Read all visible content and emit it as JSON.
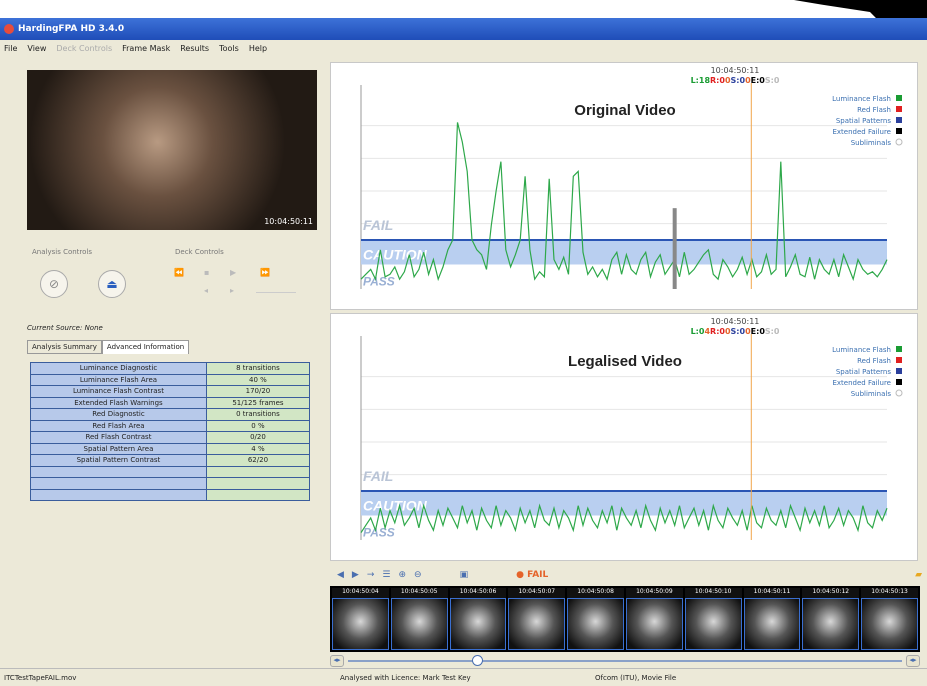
{
  "window": {
    "title": "HardingFPA HD 3.4.0"
  },
  "menu": [
    {
      "label": "File",
      "enabled": true
    },
    {
      "label": "View",
      "enabled": true
    },
    {
      "label": "Deck Controls",
      "enabled": false
    },
    {
      "label": "Frame Mask",
      "enabled": true
    },
    {
      "label": "Results",
      "enabled": true
    },
    {
      "label": "Tools",
      "enabled": true
    },
    {
      "label": "Help",
      "enabled": true
    }
  ],
  "left": {
    "video_timecode": "10:04:50:11",
    "analysis_controls_label": "Analysis Controls",
    "deck_controls_label": "Deck Controls",
    "current_source": "Current Source: None",
    "tabs": [
      "Analysis Summary",
      "Advanced Information"
    ],
    "info_rows": [
      [
        "Luminance Diagnostic",
        "8 transitions"
      ],
      [
        "Luminance Flash Area",
        "40 %"
      ],
      [
        "Luminance Flash Contrast",
        "170/20"
      ],
      [
        "Extended Flash Warnings",
        "51/125 frames"
      ],
      [
        "Red Diagnostic",
        "0 transitions"
      ],
      [
        "Red Flash Area",
        "0 %"
      ],
      [
        "Red Flash Contrast",
        "0/20"
      ],
      [
        "Spatial Pattern Area",
        "4 %"
      ],
      [
        "Spatial Pattern Contrast",
        "62/20"
      ],
      [
        "",
        ""
      ],
      [
        "",
        ""
      ],
      [
        "",
        ""
      ]
    ]
  },
  "legend": [
    "Luminance Flash",
    "Red Flash",
    "Spatial Patterns",
    "Extended Failure",
    "Subliminals"
  ],
  "legend_colors": [
    "#1a9c33",
    "#e02020",
    "#2a3f9c",
    "#000000",
    "#cccccc"
  ],
  "zones": {
    "fail": "FAIL",
    "caution": "CAUTION",
    "pass": "PASS"
  },
  "charts": {
    "original": {
      "title": "Original Video",
      "timecode": "10:04:50:11",
      "status_line": [
        {
          "t": "L:18",
          "c": "#1a9c33"
        },
        {
          "t": "R:0",
          "c": "#e02020"
        },
        {
          "t": "0",
          "c": "#e5632a"
        },
        {
          "t": "S:0",
          "c": "#2a3f9c"
        },
        {
          "t": "0",
          "c": "#e5632a"
        },
        {
          "t": "E:0",
          "c": "#000000"
        },
        {
          "t": "S:0",
          "c": "#bbbbbb"
        }
      ]
    },
    "legalised": {
      "title": "Legalised Video",
      "timecode": "10:04:50:11",
      "status_line": [
        {
          "t": "L:0",
          "c": "#1a9c33"
        },
        {
          "t": "4",
          "c": "#e5632a"
        },
        {
          "t": "R:0",
          "c": "#e02020"
        },
        {
          "t": "0",
          "c": "#e5632a"
        },
        {
          "t": "S:0",
          "c": "#2a3f9c"
        },
        {
          "t": "0",
          "c": "#e5632a"
        },
        {
          "t": "E:0",
          "c": "#000000"
        },
        {
          "t": "S:0",
          "c": "#bbbbbb"
        }
      ]
    }
  },
  "toolbar": {
    "fail_text": "FAIL"
  },
  "thumb_timecodes": [
    "10:04:50:04",
    "10:04:50:05",
    "10:04:50:06",
    "10:04:50:07",
    "10:04:50:08",
    "10:04:50:09",
    "10:04:50:10",
    "10:04:50:11",
    "10:04:50:12",
    "10:04:50:13"
  ],
  "status": {
    "file": "ITCTestTapeFAIL.mov",
    "licence": "Analysed with Licence: Mark Test Key",
    "mode": "Ofcom (ITU), Movie File"
  },
  "chart_data": [
    {
      "type": "line",
      "title": "Original Video",
      "ylim": [
        0,
        8
      ],
      "series": [
        {
          "name": "Luminance Flash",
          "values": [
            0.4,
            0.6,
            0.8,
            0.4,
            1.6,
            0.5,
            0.6,
            0.9,
            0.4,
            0.7,
            1.4,
            0.5,
            0.8,
            1.5,
            0.6,
            1.2,
            0.4,
            0.9,
            1.6,
            2.0,
            6.8,
            6.0,
            4.8,
            2.0,
            1.6,
            1.4,
            0.8,
            2.6,
            4.0,
            5.2,
            1.6,
            0.9,
            1.4,
            2.0,
            4.6,
            1.6,
            0.4,
            0.7,
            0.5,
            4.5,
            1.2,
            0.8,
            1.3,
            0.6,
            4.6,
            4.8,
            1.5,
            0.6,
            0.9,
            0.5,
            0.8,
            0.4,
            1.2,
            1.5,
            0.6,
            1.4,
            0.8,
            0.6,
            1.2,
            1.5,
            0.5,
            1.1,
            1.4,
            0.6,
            0.9,
            1.2,
            0.5,
            1.5,
            0.6,
            0.8,
            1.1,
            1.4,
            1.6,
            0.6,
            0.4,
            1.2,
            0.9,
            0.5,
            0.8,
            1.3,
            0.6,
            1.2,
            0.5,
            0.7,
            1.4,
            0.6,
            0.8,
            5.2,
            0.5,
            0.9,
            1.4,
            0.6,
            0.5,
            1.3,
            0.4,
            1.2,
            0.8,
            0.6,
            1.2,
            0.5,
            1.4,
            0.9,
            0.4,
            1.2,
            0.8,
            0.6,
            0.7,
            0.5,
            0.8,
            1.2
          ]
        },
        {
          "name": "Extended Failure",
          "values": [
            0,
            0,
            0,
            0,
            0,
            0,
            0,
            0,
            0,
            0,
            0,
            0,
            0,
            0,
            0,
            0,
            0,
            0,
            0,
            0,
            0,
            0,
            0,
            0,
            0,
            0,
            0,
            0,
            0,
            0,
            0,
            0,
            0,
            0,
            0,
            0,
            0,
            0,
            0,
            0,
            0,
            0,
            0,
            0,
            0,
            0,
            0,
            0,
            0,
            0,
            0,
            0,
            0,
            0,
            0,
            0,
            0,
            0,
            0,
            0,
            0,
            0,
            0,
            0,
            0,
            3.3,
            0,
            0,
            0,
            0,
            0,
            0,
            0,
            0,
            0,
            0,
            0,
            0,
            0,
            0,
            0,
            0,
            0,
            0,
            0,
            0,
            0,
            0,
            0,
            0,
            0,
            0,
            0,
            0,
            0,
            0,
            0,
            0,
            0,
            0,
            0,
            0,
            0,
            0,
            0,
            0,
            0,
            0,
            0,
            0
          ]
        }
      ]
    },
    {
      "type": "line",
      "title": "Legalised Video",
      "ylim": [
        0,
        8
      ],
      "series": [
        {
          "name": "Luminance Flash",
          "values": [
            0.3,
            0.6,
            0.9,
            0.4,
            1.3,
            0.5,
            1.2,
            0.7,
            1.4,
            0.6,
            0.9,
            1.3,
            0.5,
            1.4,
            0.8,
            0.4,
            1.2,
            0.6,
            1.3,
            0.9,
            0.5,
            1.4,
            0.7,
            1.2,
            0.4,
            1.3,
            0.8,
            0.5,
            1.4,
            0.6,
            1.2,
            0.9,
            0.4,
            1.3,
            0.7,
            1.2,
            0.5,
            1.4,
            0.8,
            0.6,
            1.3,
            0.5,
            1.2,
            0.9,
            0.4,
            1.4,
            0.6,
            1.3,
            0.8,
            0.5,
            1.2,
            0.7,
            1.4,
            0.4,
            1.3,
            0.9,
            0.6,
            1.2,
            0.5,
            1.4,
            0.8,
            0.4,
            1.3,
            0.7,
            1.2,
            0.6,
            1.4,
            0.5,
            0.9,
            1.3,
            0.6,
            1.2,
            0.4,
            1.4,
            0.8,
            0.5,
            1.3,
            0.9,
            0.6,
            1.2,
            0.4,
            1.4,
            0.7,
            0.5,
            1.3,
            0.8,
            0.6,
            1.2,
            0.5,
            1.4,
            0.9,
            0.4,
            1.3,
            0.7,
            1.2,
            0.6,
            1.4,
            0.5,
            0.8,
            1.3,
            0.6,
            1.2,
            0.9,
            0.4,
            1.4,
            0.7,
            0.5,
            1.2,
            0.8,
            1.3
          ]
        }
      ]
    }
  ]
}
